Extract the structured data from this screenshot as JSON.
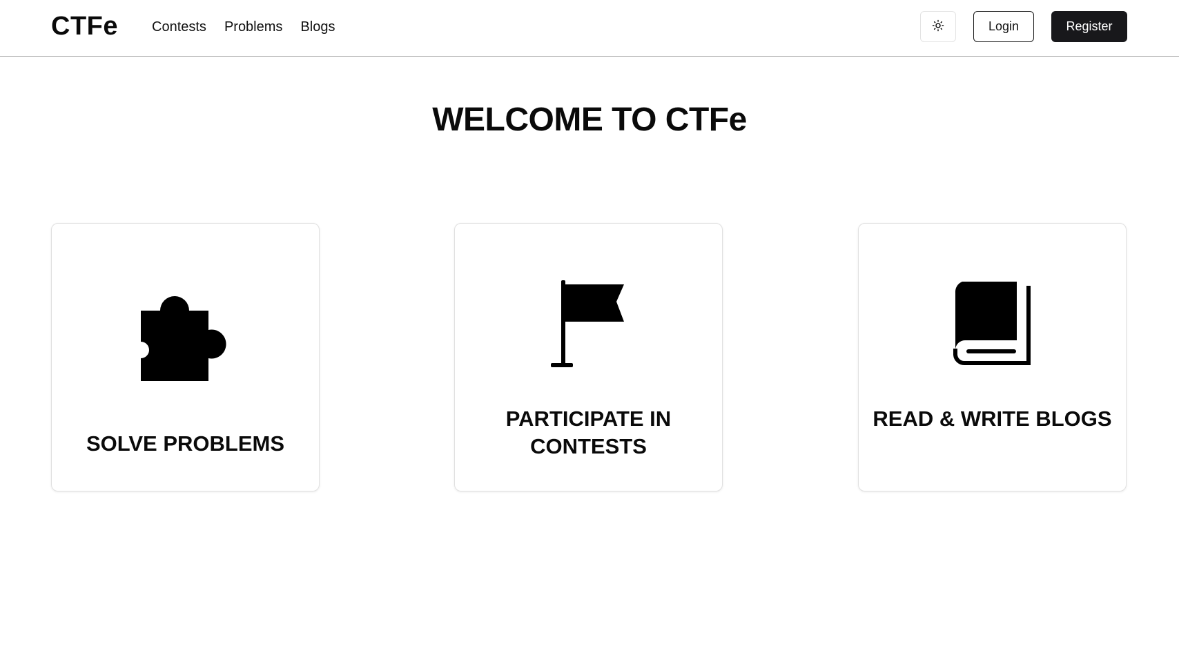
{
  "header": {
    "brand": "CTFe",
    "nav": [
      {
        "label": "Contests"
      },
      {
        "label": "Problems"
      },
      {
        "label": "Blogs"
      }
    ],
    "theme_icon": "sun-icon",
    "login_label": "Login",
    "register_label": "Register"
  },
  "hero": {
    "title": "WELCOME TO CTFe"
  },
  "cards": [
    {
      "icon": "puzzle-piece-icon",
      "title": "SOLVE PROBLEMS"
    },
    {
      "icon": "flag-icon",
      "title": "PARTICIPATE IN CONTESTS"
    },
    {
      "icon": "book-icon",
      "title": "READ & WRITE BLOGS"
    }
  ],
  "colors": {
    "text": "#0a0a0a",
    "register_bg": "#18181b",
    "border": "#e0e0e0"
  }
}
